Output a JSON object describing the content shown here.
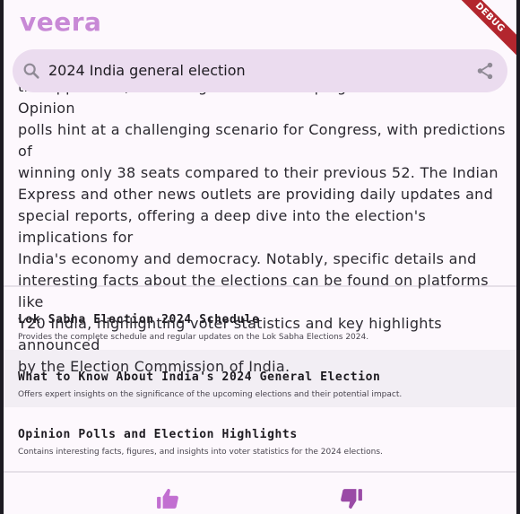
{
  "app": {
    "name": "veera",
    "debug_label": "DEBUG"
  },
  "search": {
    "query": "2024 India general election"
  },
  "summary": {
    "lines": [
      "the opposition, indicating a heated campaign season ahead. Opinion",
      "polls hint at a challenging scenario for Congress, with predictions of",
      "winning only 38 seats compared to their previous 52. The Indian",
      "Express and other news outlets are providing daily updates and",
      "special reports, offering a deep dive into the election's implications for",
      "India's economy and democracy. Notably, specific details and",
      "interesting facts about the elections can be found on platforms like",
      "Y20 India, highlighting voter statistics and key highlights announced",
      "by the Election Commission of India."
    ]
  },
  "results": [
    {
      "title": "Lok Sabha Election 2024 Schedule",
      "description": "Provides the complete schedule and regular updates on the Lok Sabha Elections 2024."
    },
    {
      "title": "What to Know About India's 2024 General Election",
      "description": "Offers expert insights on the significance of the upcoming elections and their potential impact."
    },
    {
      "title": "Opinion Polls and Election Highlights",
      "description": "Contains interesting facts, figures, and insights into voter statistics for the 2024 elections."
    }
  ],
  "icons": {
    "search": "search-icon",
    "share": "share-icon",
    "like": "thumb-up-icon",
    "dislike": "thumb-down-icon"
  },
  "colors": {
    "brand": "#c889d6",
    "thumb_up": "#c26fd1",
    "thumb_down": "#9a4ba6",
    "search_bg": "#ebdcef",
    "debug": "#b3262e"
  }
}
